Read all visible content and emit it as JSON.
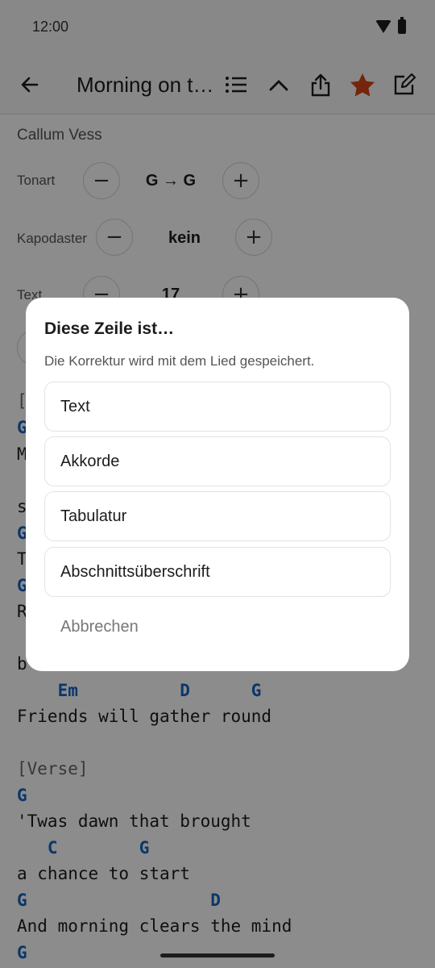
{
  "status_bar": {
    "time": "12:00"
  },
  "app_bar": {
    "title": "Morning on t…",
    "icons": [
      "back-arrow-icon",
      "list-icon",
      "chevron-up-icon",
      "share-icon",
      "star-icon",
      "edit-icon"
    ]
  },
  "song": {
    "artist": "Callum Vess",
    "controls": {
      "key": {
        "label": "Tonart",
        "value": "G → G",
        "minus": "−",
        "plus": "+"
      },
      "capo": {
        "label": "Kapodaster",
        "value": "kein",
        "minus": "−",
        "plus": "+"
      },
      "text": {
        "label": "Text",
        "value": "17",
        "minus": "−",
        "plus": "+"
      }
    },
    "left_fragments": [
      "[",
      "G",
      "M",
      "s",
      "G",
      "T",
      "G",
      "R",
      "b"
    ],
    "lines": [
      {
        "type": "chord",
        "text": "    Em          D      G"
      },
      {
        "type": "lyric",
        "text": "Friends will gather round"
      },
      {
        "type": "section",
        "text": "[Verse]"
      },
      {
        "type": "chord",
        "text": "G"
      },
      {
        "type": "lyric",
        "text": "'Twas dawn that brought"
      },
      {
        "type": "chord",
        "text": "   C        G"
      },
      {
        "type": "lyric",
        "text": "a chance to start"
      },
      {
        "type": "chord",
        "text": "G                  D"
      },
      {
        "type": "lyric",
        "text": "And morning clears the mind"
      },
      {
        "type": "chord",
        "text": "G"
      }
    ]
  },
  "dialog": {
    "title": "Diese Zeile ist…",
    "subtitle": "Die Korrektur wird mit dem Lied gespeichert.",
    "options": [
      "Text",
      "Akkorde",
      "Tabulatur",
      "Abschnittsüberschrift"
    ],
    "cancel": "Abbrechen"
  },
  "colors": {
    "accent_star": "#d84315",
    "chord": "#1565c0"
  }
}
